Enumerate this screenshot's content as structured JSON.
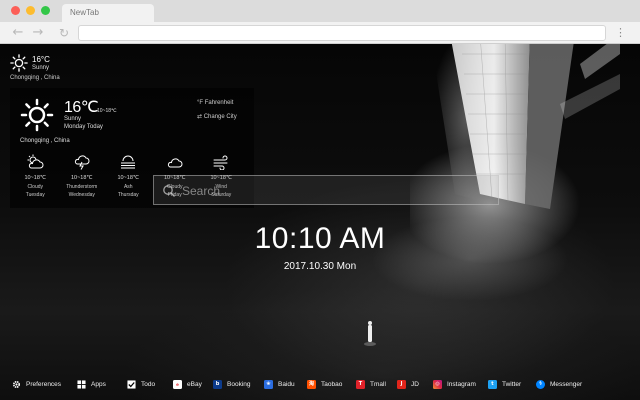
{
  "browser": {
    "tab_title": "NewTab",
    "back_icon": "arrow-left-icon",
    "forward_icon": "arrow-right-icon",
    "reload_icon": "reload-icon",
    "menu_icon": "menu-dots-icon"
  },
  "mini_weather": {
    "icon": "sun-icon",
    "temp": "16°C",
    "condition": "Sunny",
    "city": "Chongqing , China"
  },
  "weather": {
    "icon": "sun-icon",
    "temp": "16℃",
    "range": "10~18℃",
    "condition": "Sunny",
    "day": "Monday Today",
    "city": "Chongqing , China",
    "fahrenheit_label": "°F  Fahrenheit",
    "change_city_label": "⇄  Change City",
    "forecast": [
      {
        "icon": "cloudy-sun-icon",
        "range": "10~18℃",
        "condition": "Cloudy",
        "day": "Tuesday"
      },
      {
        "icon": "thunderstorm-icon",
        "range": "10~18℃",
        "condition": "Thunderstorm",
        "day": "Wednesday"
      },
      {
        "icon": "ash-icon",
        "range": "10~18℃",
        "condition": "Ash",
        "day": "Thursday"
      },
      {
        "icon": "cloud-icon",
        "range": "10~18℃",
        "condition": "Cloudy",
        "day": "Friday"
      },
      {
        "icon": "wind-icon",
        "range": "10~18℃",
        "condition": "Wind",
        "day": "Saturday"
      }
    ]
  },
  "search": {
    "placeholder": "Search",
    "icon": "search-icon"
  },
  "clock": {
    "time": "10:10 AM",
    "date": "2017.10.30 Mon"
  },
  "bottom_bar": [
    {
      "label": "Preferences",
      "icon": "gear-icon",
      "color": "#ffffff"
    },
    {
      "label": "Apps",
      "icon": "apps-grid-icon",
      "color": "#ffffff"
    },
    {
      "label": "Todo",
      "icon": "checkbox-icon",
      "color": "#ffffff"
    },
    {
      "label": "eBay",
      "icon": "ebay-icon",
      "color": "#ffffff"
    },
    {
      "label": "Booking",
      "icon": "booking-icon",
      "color": "#0c3b8c"
    },
    {
      "label": "Baidu",
      "icon": "baidu-icon",
      "color": "#2b6de0"
    },
    {
      "label": "Taobao",
      "icon": "taobao-icon",
      "color": "#ff5000"
    },
    {
      "label": "Tmall",
      "icon": "tmall-icon",
      "color": "#e0222a"
    },
    {
      "label": "JD",
      "icon": "jd-icon",
      "color": "#e1251b"
    },
    {
      "label": "Instagram",
      "icon": "instagram-icon",
      "color": "#c13584"
    },
    {
      "label": "Twitter",
      "icon": "twitter-icon",
      "color": "#1da1f2"
    },
    {
      "label": "Messenger",
      "icon": "messenger-icon",
      "color": "#0084ff"
    }
  ]
}
